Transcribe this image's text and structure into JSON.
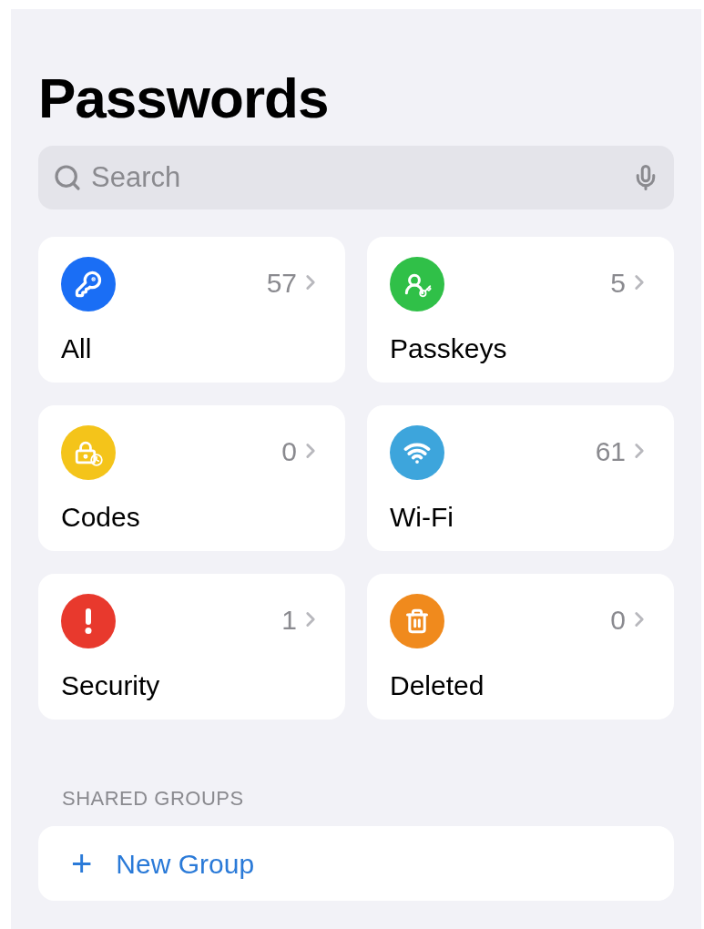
{
  "title": "Passwords",
  "search": {
    "placeholder": "Search"
  },
  "categories": [
    {
      "label": "All",
      "count": "57",
      "color": "#1a6ef5"
    },
    {
      "label": "Passkeys",
      "count": "5",
      "color": "#30c048"
    },
    {
      "label": "Codes",
      "count": "0",
      "color": "#f4c41a"
    },
    {
      "label": "Wi-Fi",
      "count": "61",
      "color": "#3da5dc"
    },
    {
      "label": "Security",
      "count": "1",
      "color": "#e8392d"
    },
    {
      "label": "Deleted",
      "count": "0",
      "color": "#f08a1d"
    }
  ],
  "shared_groups": {
    "heading": "SHARED GROUPS",
    "new_group": {
      "icon": "+",
      "label": "New Group"
    }
  }
}
